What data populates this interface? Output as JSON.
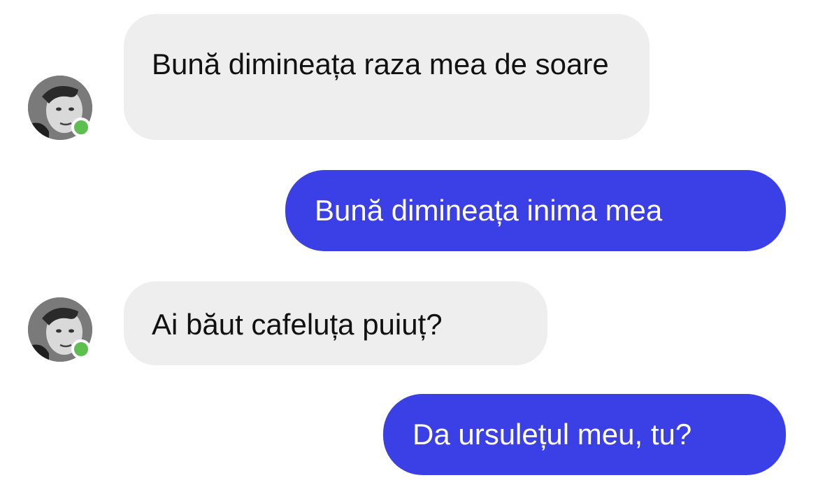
{
  "conversation": {
    "messages": [
      {
        "sender": "contact",
        "text": "Bună dimineața raza mea de soare"
      },
      {
        "sender": "me",
        "text": "Bună dimineața inima mea"
      },
      {
        "sender": "contact",
        "text": "Ai băut cafeluța puiuț?"
      },
      {
        "sender": "me",
        "text": "Da ursulețul meu, tu?"
      }
    ]
  },
  "contact": {
    "status": "online",
    "avatar_icon": "profile-photo-icon",
    "status_icon": "online-dot-icon"
  },
  "colors": {
    "incoming_bubble": "#eeeeee",
    "outgoing_bubble": "#3b3fe6",
    "online_indicator": "#5cbf4f",
    "background": "#ffffff"
  }
}
